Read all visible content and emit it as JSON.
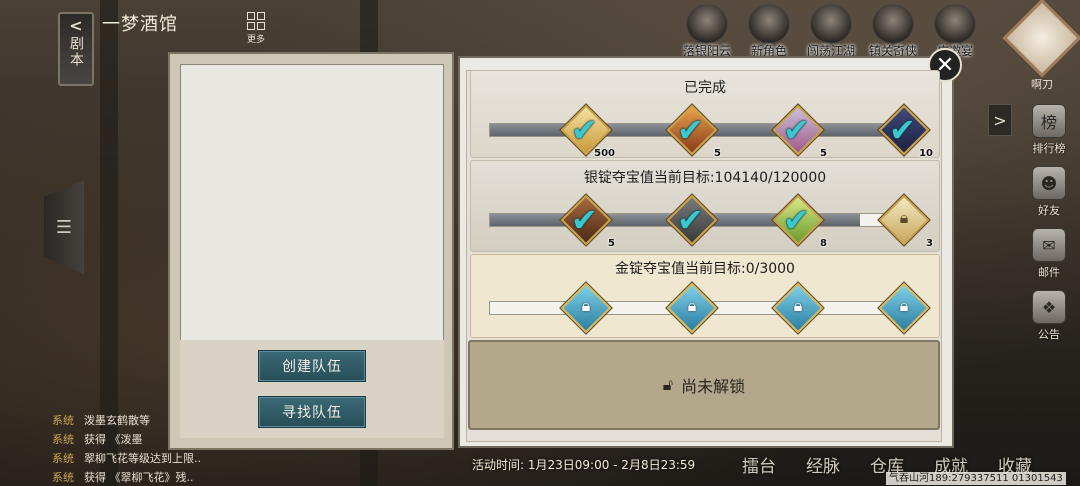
{
  "header": {
    "back_label": "剧本",
    "place_title": "一梦酒馆",
    "more_label": "更多"
  },
  "top_icons": [
    {
      "label": "落银阳云",
      "icon": "character-portrait-icon"
    },
    {
      "label": "新角色",
      "icon": "character-portrait-icon"
    },
    {
      "label": "闯荡江湖",
      "icon": "character-portrait-icon"
    },
    {
      "label": "镇关奇侠",
      "icon": "character-portrait-icon"
    },
    {
      "label": "广邀宴",
      "icon": "character-portrait-icon"
    }
  ],
  "avatar": {
    "name": "啊刀"
  },
  "right_nav": [
    {
      "label": "排行榜",
      "icon": "ranking-icon",
      "glyph": "榜"
    },
    {
      "label": "好友",
      "icon": "friends-icon",
      "glyph": "☻"
    },
    {
      "label": "邮件",
      "icon": "mail-icon",
      "glyph": "✉"
    },
    {
      "label": "公告",
      "icon": "announcement-icon",
      "glyph": "❖"
    }
  ],
  "chat": [
    {
      "tag": "系统",
      "text": "泼墨玄鹤散等"
    },
    {
      "tag": "系统",
      "text": "获得 《泼墨"
    },
    {
      "tag": "系统",
      "text": "翠柳飞花等级达到上限.."
    },
    {
      "tag": "系统",
      "text": "获得 《翠柳飞花》残.."
    }
  ],
  "team": {
    "create_label": "创建队伍",
    "find_label": "寻找队伍"
  },
  "tiers": {
    "completed": {
      "title": "已完成",
      "progress": 1.0,
      "rewards": [
        {
          "qty": "500",
          "state": "claimed",
          "icon": "reward-item-icon"
        },
        {
          "qty": "5",
          "state": "claimed",
          "icon": "reward-item-icon"
        },
        {
          "qty": "5",
          "state": "claimed",
          "icon": "reward-item-icon"
        },
        {
          "qty": "10",
          "state": "claimed",
          "icon": "reward-item-icon"
        }
      ]
    },
    "silver": {
      "title": "银锭夺宝值当前目标:104140/120000",
      "current": 104140,
      "target": 120000,
      "rewards": [
        {
          "qty": "5",
          "state": "claimed",
          "icon": "reward-item-icon"
        },
        {
          "qty": "",
          "state": "claimed",
          "icon": "reward-item-icon"
        },
        {
          "qty": "8",
          "state": "claimed",
          "icon": "reward-item-icon"
        },
        {
          "qty": "3",
          "state": "locked",
          "icon": "lock-icon"
        }
      ]
    },
    "gold": {
      "title": "金锭夺宝值当前目标:0/3000",
      "current": 0,
      "target": 3000,
      "rewards": [
        {
          "state": "locked",
          "icon": "lock-icon"
        },
        {
          "state": "locked",
          "icon": "lock-icon"
        },
        {
          "state": "locked",
          "icon": "lock-icon"
        },
        {
          "state": "locked",
          "icon": "lock-icon"
        }
      ]
    },
    "locked": {
      "label": "尚未解锁"
    }
  },
  "footer": {
    "activity_time": "活动时间: 1月23日09:00 - 2月8日23:59",
    "menu": [
      "擂台",
      "经脉",
      "仓库",
      "成就",
      "收藏"
    ],
    "server_info": "气吞山河189:279337511 01301543"
  },
  "colors": {
    "accent_teal": "#39c7d0",
    "button_teal": "#2f5f6a",
    "panel_beige": "#ece9e2",
    "locked_tan": "#b3a78c"
  }
}
